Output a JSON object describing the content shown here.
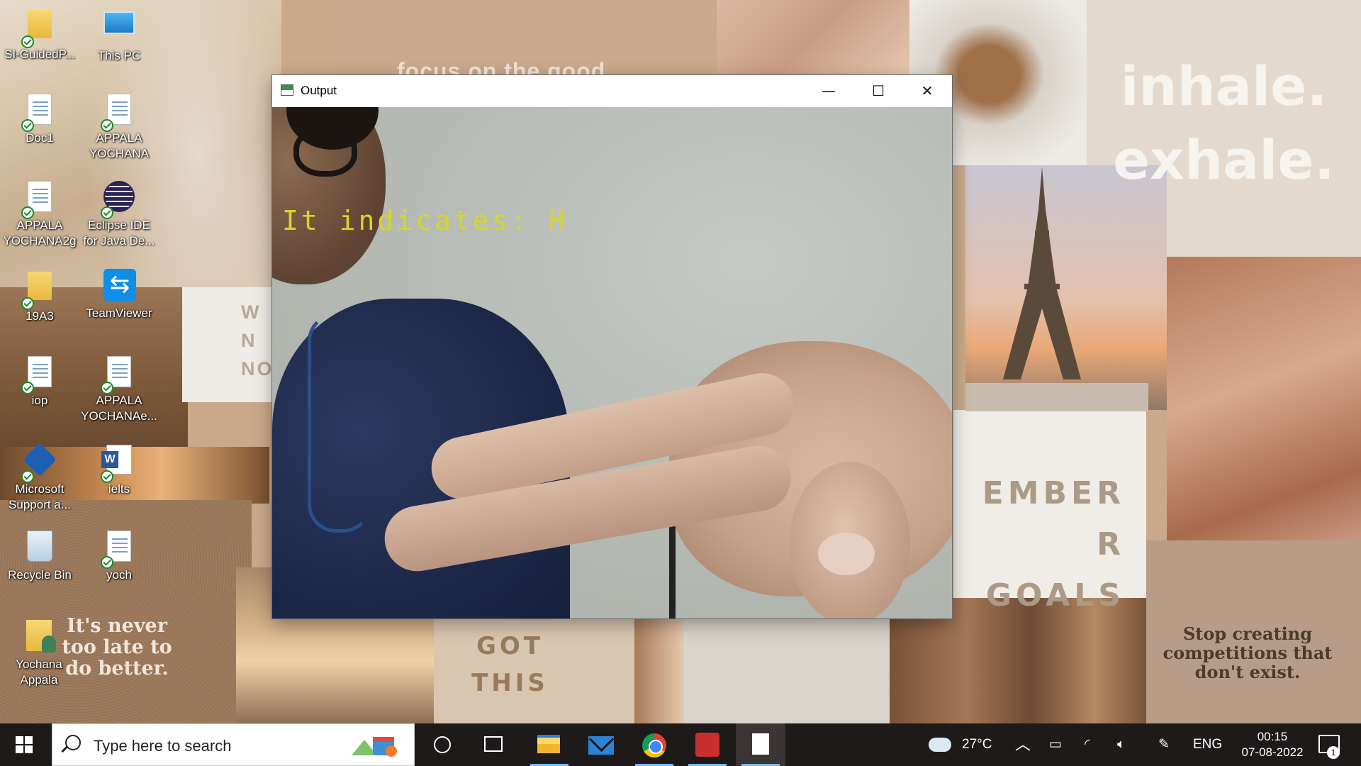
{
  "wallpaper": {
    "focus_text": "focus on the good",
    "w_card_lines": [
      "W",
      "N",
      "NO"
    ],
    "inhale_lines": [
      "inhale.",
      "exhale."
    ],
    "goals_lines": [
      "EMBER",
      "R GOALS"
    ],
    "gotthis_lines": [
      "GOT",
      "THIS"
    ],
    "cork_quote": "It's never too late to do better.",
    "stop_quote": "Stop creating competitions that don't exist."
  },
  "desktop_icons": [
    {
      "name": "SI-GuidedP...",
      "type": "folder"
    },
    {
      "name": "This PC",
      "type": "pc"
    },
    {
      "name": "Doc1",
      "type": "doc"
    },
    {
      "name": "APPALA YOCHANA",
      "type": "doc"
    },
    {
      "name": "APPALA YOCHANA2g",
      "type": "doc"
    },
    {
      "name": "Eclipse IDE for Java De...",
      "type": "eclipse"
    },
    {
      "name": "19A3",
      "type": "folder"
    },
    {
      "name": "TeamViewer",
      "type": "teamviewer"
    },
    {
      "name": "iop",
      "type": "doc"
    },
    {
      "name": "APPALA YOCHANAe...",
      "type": "doc"
    },
    {
      "name": "Microsoft Support a...",
      "type": "ms"
    },
    {
      "name": "ielts",
      "type": "word"
    },
    {
      "name": "Recycle Bin",
      "type": "bin"
    },
    {
      "name": "yoch",
      "type": "doc"
    },
    {
      "name": "Yochana Appala",
      "type": "user"
    }
  ],
  "window": {
    "title": "Output",
    "minimize_glyph": "—",
    "maximize_glyph": "☐",
    "close_glyph": "✕",
    "overlay_text": "It indicates: H"
  },
  "taskbar": {
    "search_placeholder": "Type here to search",
    "weather": "27°C",
    "language": "ENG",
    "time": "00:15",
    "date": "07-08-2022",
    "notification_count": "1",
    "pinned": [
      "cortana-icon",
      "task-view-icon",
      "file-explorer-icon",
      "mail-icon",
      "chrome-icon",
      "app-icon",
      "notepad-icon"
    ]
  },
  "colors": {
    "taskbar_bg": "#1f1a1a",
    "overlay_text": "#d6d62a",
    "active_indicator": "#76b9ed"
  }
}
